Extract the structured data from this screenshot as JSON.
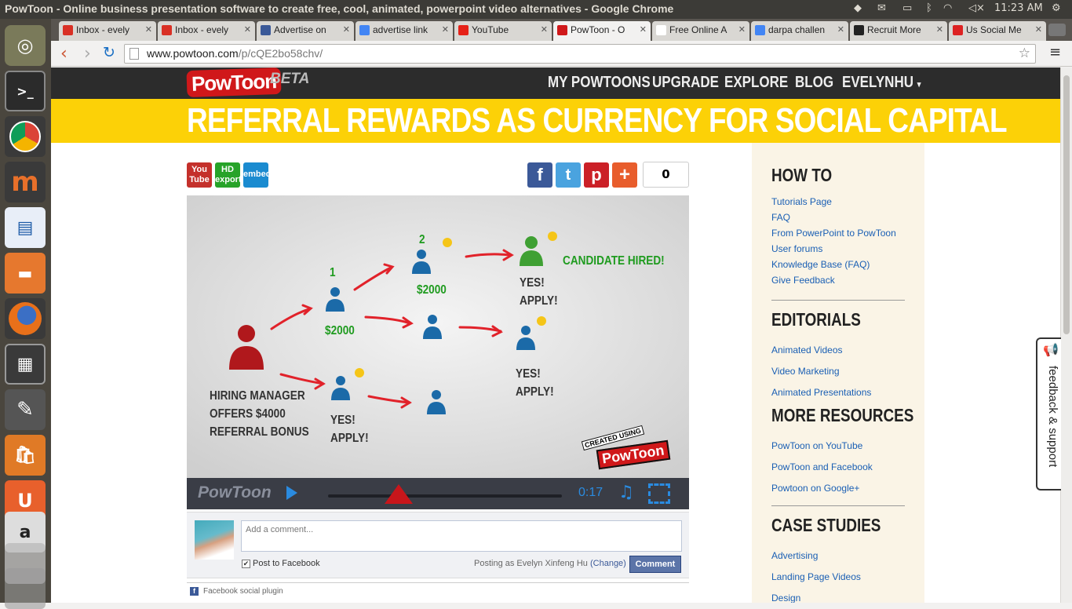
{
  "system": {
    "window_title": "PowToon - Online business presentation software to create free, cool, animated, powerpoint video alternatives - Google Chrome",
    "clock": "11:23 AM"
  },
  "tabs": [
    {
      "label": "Inbox - evely",
      "color": "#d93025"
    },
    {
      "label": "Inbox - evely",
      "color": "#d93025"
    },
    {
      "label": "Advertise on",
      "color": "#3b5998"
    },
    {
      "label": "advertise link",
      "color": "#4285f4"
    },
    {
      "label": "YouTube",
      "color": "#e62117"
    },
    {
      "label": "PowToon - O",
      "color": "#d0181a"
    },
    {
      "label": "Free Online A",
      "color": "#ffffff"
    },
    {
      "label": "darpa challen",
      "color": "#4285f4"
    },
    {
      "label": "Recruit More",
      "color": "#222222"
    },
    {
      "label": "Us Social Me",
      "color": "#dd2222"
    }
  ],
  "toolbar": {
    "url_host": "www.powtoon.com",
    "url_path": "/p/cQE2bo58chv/"
  },
  "site": {
    "logo": "PowToon",
    "beta": "BETA",
    "nav": [
      "MY POWTOONS",
      "UPGRADE",
      "EXPLORE",
      "BLOG",
      "EVELYNHU"
    ],
    "banner_title": "REFERRAL REWARDS AS CURRENCY FOR SOCIAL CAPITAL",
    "share_count": "0",
    "colors": {
      "nav": "#2c2c2c",
      "banner": "#fcd107",
      "accent": "#d0181a"
    }
  },
  "share": {
    "youtube": "You Tube",
    "hd": "HD export",
    "embed": "embed"
  },
  "video": {
    "hiring_manager": [
      "HIRING MANAGER",
      "OFFERS $4000",
      "REFERRAL BONUS"
    ],
    "step1": "1",
    "step2": "2",
    "amount1": "$2000",
    "amount2": "$2000",
    "candidate_hired": "CANDIDATE HIRED!",
    "yes_apply": [
      "YES!",
      "APPLY!"
    ],
    "created_using": "CREATED USING",
    "created_brand": "PowToon",
    "controls_logo": "PowToon",
    "time": "0:17"
  },
  "comments": {
    "placeholder": "Add a comment...",
    "post_to_facebook": "Post to Facebook",
    "posting_as": "Posting as Evelyn Xinfeng Hu",
    "change": "(Change)",
    "comment_button": "Comment",
    "plugin": "Facebook social plugin"
  },
  "sidebar": {
    "sections": [
      {
        "title": "HOW TO",
        "links": [
          "Tutorials Page",
          "FAQ",
          "From PowerPoint to PowToon",
          "User forums",
          "Knowledge Base (FAQ)",
          "Give Feedback"
        ]
      },
      {
        "title": "EDITORIALS",
        "links": [
          "Animated Videos",
          "Video Marketing",
          "Animated Presentations"
        ]
      },
      {
        "title": "MORE RESOURCES",
        "links": [
          "PowToon on YouTube",
          "PowToon and Facebook",
          "Powtoon on Google+"
        ]
      },
      {
        "title": "CASE STUDIES",
        "links": [
          "Advertising",
          "Landing Page Videos",
          "Design"
        ]
      }
    ]
  },
  "feedback_tab": "feedback & support"
}
